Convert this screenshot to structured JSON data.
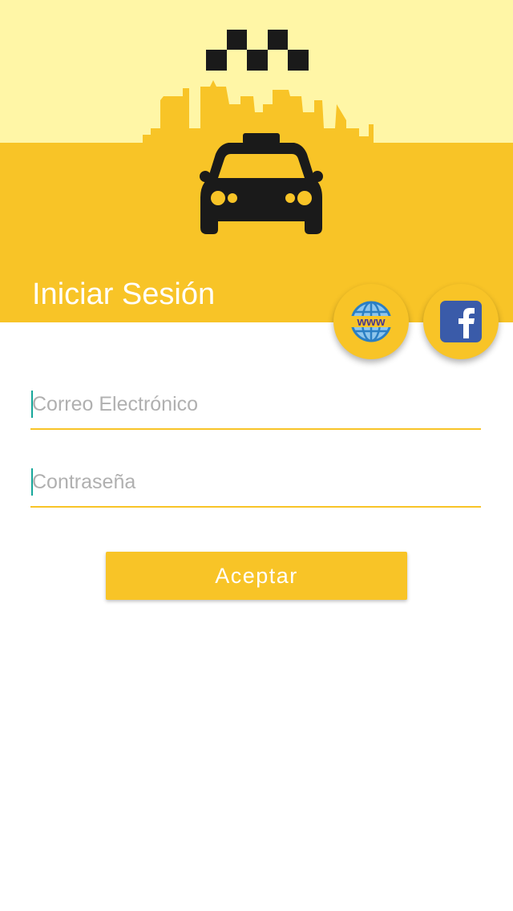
{
  "header": {
    "title": "Iniciar Sesión",
    "colors": {
      "light": "#FFF6A6",
      "accent": "#F8C427",
      "icon_dark": "#1a1a1a"
    },
    "hero_icon": "taxi-city-icon"
  },
  "social": {
    "web_icon": "www-globe-icon",
    "facebook_icon": "facebook-icon"
  },
  "form": {
    "email_placeholder": "Correo Electrónico",
    "email_value": "",
    "password_placeholder": "Contraseña",
    "password_value": "",
    "submit_label": "Aceptar"
  }
}
